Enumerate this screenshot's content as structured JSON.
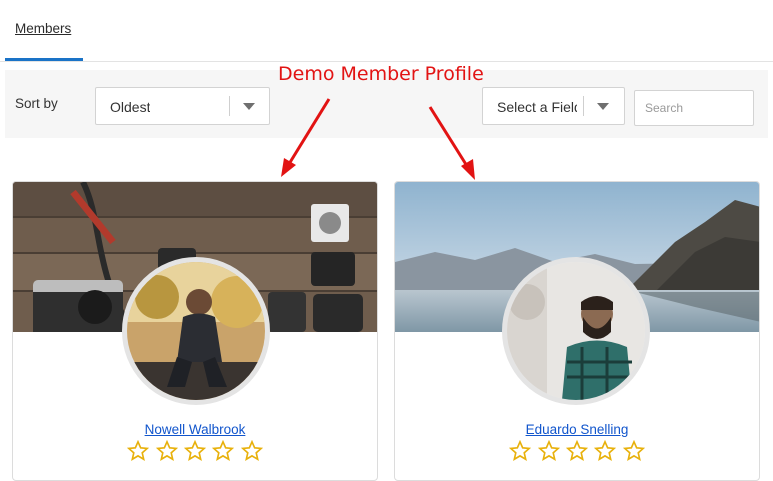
{
  "tabs": [
    {
      "label": "Members",
      "active": true
    }
  ],
  "filters": {
    "sort_label": "Sort by",
    "sort_value": "Oldest",
    "field_value": "Select a Field",
    "search_placeholder": "Search"
  },
  "annotation": {
    "text": "Demo Member Profile",
    "color": "#e21313"
  },
  "members": [
    {
      "name": "Nowell Walbrook",
      "rating": 0,
      "max_rating": 5,
      "cover": "camera-on-wooden-table",
      "avatar": "man-sitting-outdoors"
    },
    {
      "name": "Eduardo Snelling",
      "rating": 0,
      "max_rating": 5,
      "cover": "mountain-lake",
      "avatar": "bearded-man-plaid-shirt"
    }
  ],
  "colors": {
    "accent": "#1a73c7",
    "link": "#1155cc",
    "star": "#e8b10c"
  }
}
